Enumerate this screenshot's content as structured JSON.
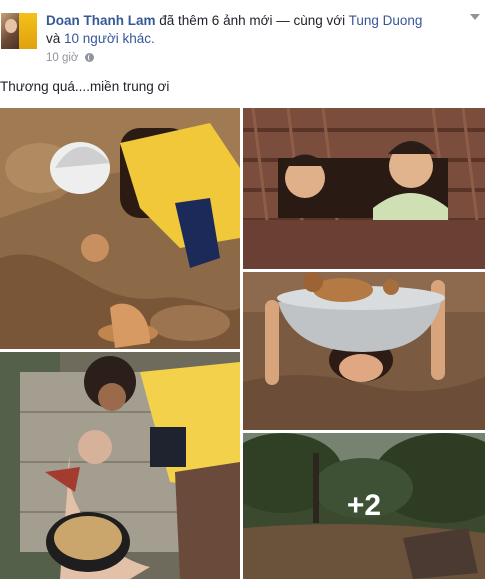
{
  "post": {
    "author": "Doan Thanh Lam",
    "action": "đã thêm 6 ảnh mới",
    "separator": "— cùng với",
    "tagged": "Tung Duong",
    "conj": "và",
    "others": "10 người khác.",
    "time": "10 giờ",
    "privacy_icon": "globe-icon",
    "menu_icon": "chevron-down-icon",
    "status": "Thương quá....miền trung ơi"
  },
  "photos": {
    "more_count": "+2"
  }
}
